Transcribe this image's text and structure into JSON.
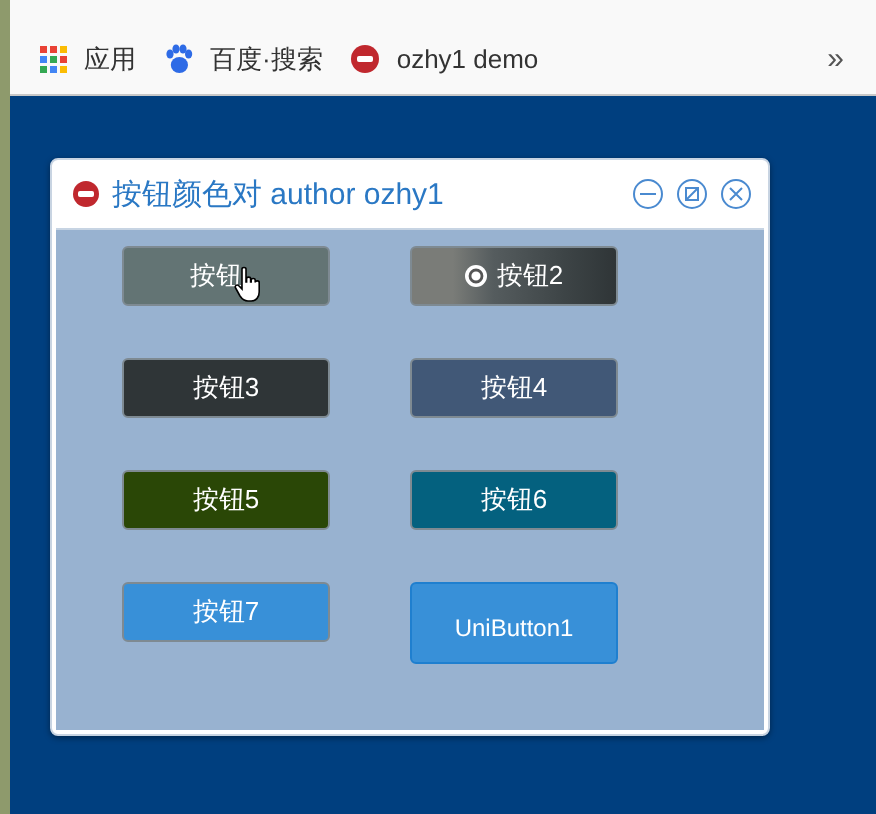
{
  "bookmarks": [
    {
      "label": "应用",
      "kind": "apps"
    },
    {
      "label": "百度·搜索",
      "kind": "paw"
    },
    {
      "label": "ozhy1 demo",
      "kind": "dx"
    }
  ],
  "bookmarks_more": "»",
  "window": {
    "title": "按钮颜色对 author ozhy1"
  },
  "buttons": [
    {
      "label": "按钮",
      "kind": "hover",
      "color": "#637474"
    },
    {
      "label": "按钮2",
      "kind": "gradient",
      "color": "#2f3537"
    },
    {
      "label": "按钮3",
      "kind": "plain",
      "color": "#2f3537"
    },
    {
      "label": "按钮4",
      "kind": "plain",
      "color": "#415877"
    },
    {
      "label": "按钮5",
      "kind": "plain",
      "color": "#2a4706"
    },
    {
      "label": "按钮6",
      "kind": "plain",
      "color": "#04617f"
    },
    {
      "label": "按钮7",
      "kind": "plain",
      "color": "#3890d8"
    },
    {
      "label": "UniButton1",
      "kind": "uni",
      "color": "#3890d8"
    }
  ]
}
